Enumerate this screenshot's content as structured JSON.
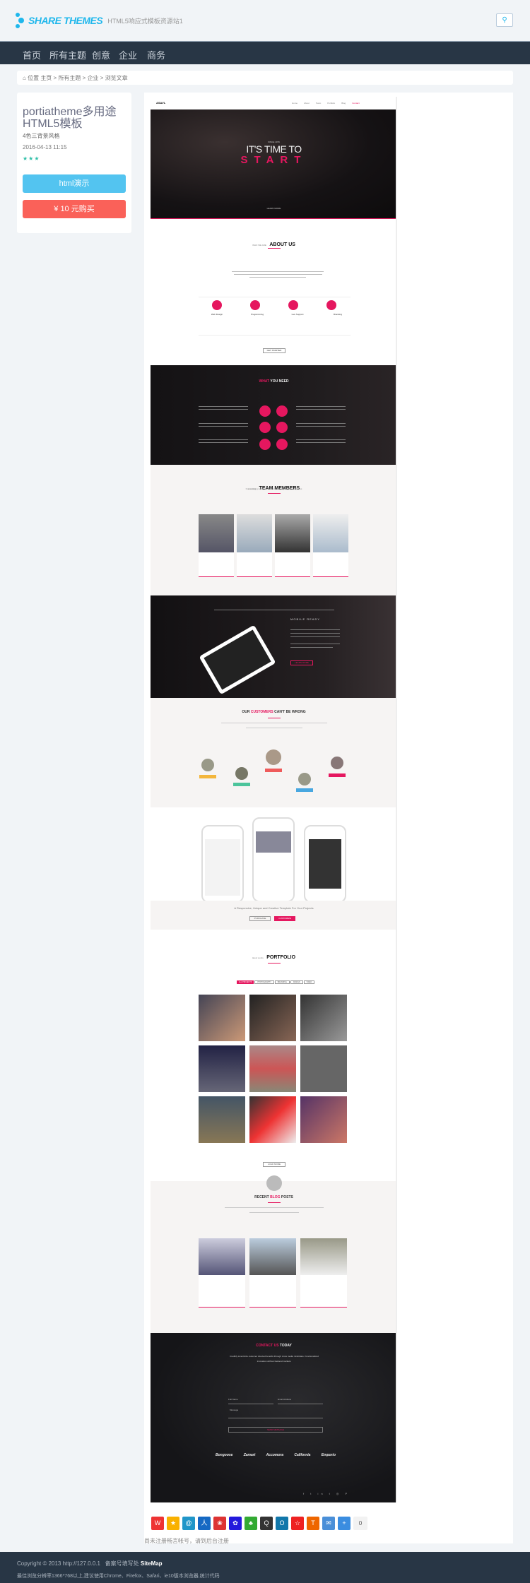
{
  "header": {
    "logo_text": "SHARE THEMES",
    "tagline": "HTML5响应式模板资源站1",
    "search_icon": "search-icon"
  },
  "nav": {
    "items": [
      "首页",
      "所有主题",
      "创意",
      "企业",
      "商务"
    ]
  },
  "breadcrumb": {
    "prefix": "位置",
    "items": [
      "主页",
      "所有主题",
      "企业",
      "浏览文章"
    ],
    "separator": ">"
  },
  "product": {
    "title": "portiatheme多用途HTML5模板",
    "subtitle": "4色三背景风格",
    "date": "2016-04-13 11:15",
    "rating": 3,
    "demo_label": "html演示",
    "buy_label": "¥ 10 元购买",
    "colors": {
      "demo": "#53c4f0",
      "buy": "#fa6159",
      "star": "#2fbfa8"
    }
  },
  "preview": {
    "brand": "ASAVL",
    "menu": [
      "Home",
      "About",
      "Team",
      "Portfolio",
      "Blog",
      "Contact"
    ],
    "hero": {
      "since": "SINCE 1976",
      "line1": "IT'S TIME TO",
      "line2": "START",
      "button": "LEARN MORE"
    },
    "about": {
      "kicker": "WHO WE ARE",
      "title": "ABOUT US",
      "features": [
        "Web Design",
        "Programming",
        "Live Support",
        "Branding"
      ],
      "see_more": "SEE MORE >",
      "button": "GET STARTED"
    },
    "what": {
      "title_accent": "WHAT",
      "title_rest": "YOU NEED"
    },
    "team": {
      "kicker": "amazing",
      "title": "TEAM MEMBERS",
      "subtitle": "Our amazing team members are working for your happiness"
    },
    "mobile": {
      "title": "MOBILE READY",
      "button": "LEARN MORE"
    },
    "customers": {
      "title_pre": "OUR",
      "title_accent": "CUSTOMERS",
      "title_post": "CAN'T BE WRONG"
    },
    "tagline": {
      "text": "A Responsive, Unique and Creative Template For Your Projects",
      "buttons": [
        "PURCHASE",
        "CUSTOMIZE"
      ]
    },
    "portfolio": {
      "kicker": "latest works",
      "title": "PORTFOLIO",
      "filters": [
        "ALL PROJECTS",
        "PHOTOGRAPHY",
        "BRANDING",
        "DESIGN",
        "VIDEO"
      ],
      "button": "LOAD MORE"
    },
    "blog": {
      "title_pre": "RECENT",
      "title_accent": "BLOG",
      "title_post": "POSTS"
    },
    "contact": {
      "title_accent": "CONTACT US",
      "title_rest": "TODAY",
      "text": "Credibly incentivize customer directed benefits through cross media mindshare. Functionalized innovation without backend markets.",
      "fields": [
        "Full Name",
        "Email Address",
        "Message"
      ],
      "button": "SEND MESSAGE",
      "brands": [
        "Bongoose",
        "Zamart",
        "Accomora",
        "California",
        "Emporio"
      ]
    },
    "accent": "#e5175f"
  },
  "share": {
    "icons": [
      "weibo-icon",
      "qzone-icon",
      "tencent-weibo-icon",
      "renren-icon",
      "kaixin-icon",
      "baidu-icon",
      "clover-icon",
      "qq-icon",
      "douban-icon",
      "star-icon",
      "tianya-icon",
      "email-icon",
      "plus-icon"
    ],
    "count": "0",
    "note": "尚未注册畅言帐号，请到后台注册"
  },
  "footer": {
    "copyright": "Copyright © 2013 http://127.0.0.1",
    "icp": "备案号填写处",
    "sitemap": "SiteMap",
    "note": "最佳浏览分辨率1366*768以上,建议使用Chrome、Firefox、Safari、ie10版本浏览器,统计代码"
  },
  "colors": {
    "nav_bg": "#283645",
    "brand": "#1fb7ec"
  }
}
